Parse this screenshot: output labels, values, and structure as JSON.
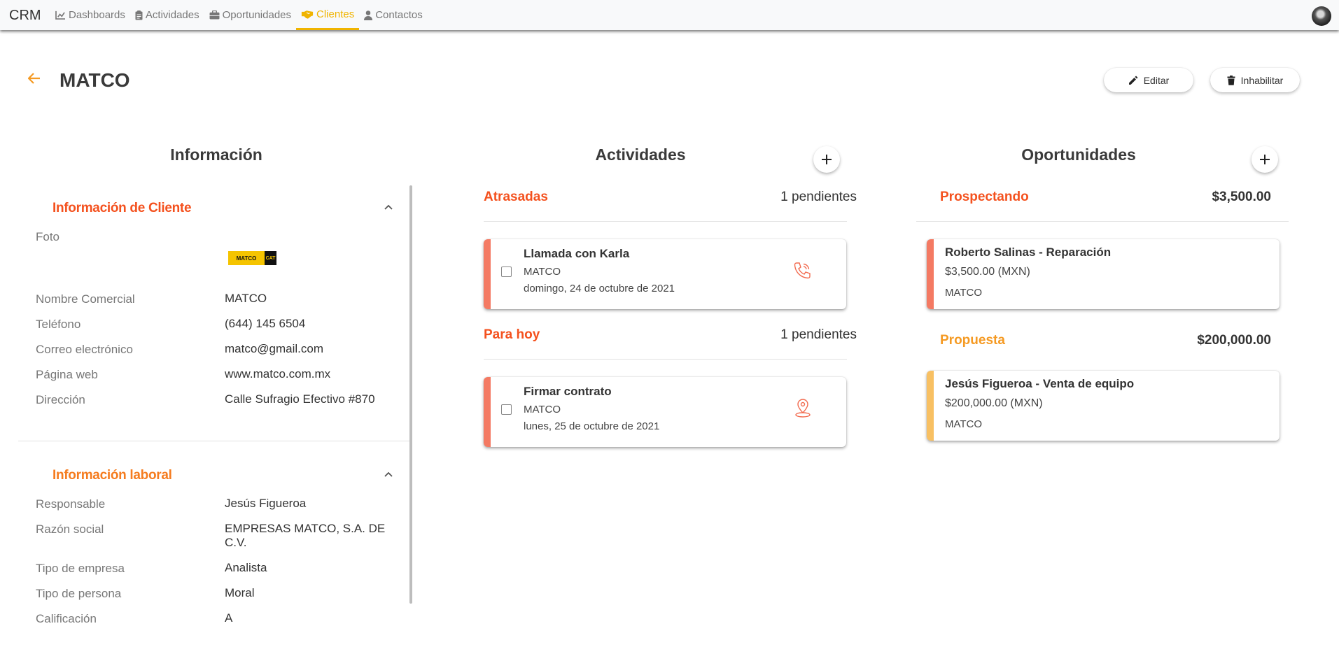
{
  "nav": {
    "brand": "CRM",
    "items": [
      {
        "label": "Dashboards",
        "icon": "chart-line-icon"
      },
      {
        "label": "Actividades",
        "icon": "clipboard-icon"
      },
      {
        "label": "Oportunidades",
        "icon": "briefcase-icon"
      },
      {
        "label": "Clientes",
        "icon": "handshake-icon",
        "active": true
      },
      {
        "label": "Contactos",
        "icon": "user-icon"
      }
    ],
    "accent_color": "#f0b400"
  },
  "header": {
    "title": "MATCO",
    "edit_label": "Editar",
    "disable_label": "Inhabilitar"
  },
  "info": {
    "title": "Información",
    "client_section": {
      "title": "Información de Cliente",
      "color": "#f4511e",
      "photo_label": "Foto",
      "logo_text": "MATCO",
      "logo_badge": "CAT",
      "fields": [
        {
          "label": "Nombre Comercial",
          "value": "MATCO"
        },
        {
          "label": "Teléfono",
          "value": "(644) 145 6504"
        },
        {
          "label": "Correo electrónico",
          "value": "matco@gmail.com"
        },
        {
          "label": "Página web",
          "value": "www.matco.com.mx"
        },
        {
          "label": "Dirección",
          "value": "Calle Sufragio Efectivo #870"
        }
      ]
    },
    "work_section": {
      "title": "Información laboral",
      "color": "#f57c1f",
      "fields": [
        {
          "label": "Responsable",
          "value": "Jesús Figueroa"
        },
        {
          "label": "Razón social",
          "value": "EMPRESAS MATCO, S.A. DE C.V."
        },
        {
          "label": "Tipo de empresa",
          "value": "Analista"
        },
        {
          "label": "Tipo de persona",
          "value": "Moral"
        },
        {
          "label": "Calificación",
          "value": "A"
        }
      ]
    }
  },
  "activities": {
    "title": "Actividades",
    "groups": [
      {
        "title": "Atrasadas",
        "pending": "1 pendientes",
        "color": "#f4511e",
        "items": [
          {
            "title": "Llamada con Karla",
            "company": "MATCO",
            "date": "domingo, 24 de octubre de 2021",
            "icon": "phone-icon"
          }
        ]
      },
      {
        "title": "Para hoy",
        "pending": "1 pendientes",
        "color": "#f4511e",
        "items": [
          {
            "title": "Firmar contrato",
            "company": "MATCO",
            "date": "lunes, 25 de octubre de 2021",
            "icon": "location-pin-icon"
          }
        ]
      }
    ],
    "stripe_color": "#f47a63"
  },
  "opportunities": {
    "title": "Oportunidades",
    "groups": [
      {
        "title": "Prospectando",
        "amount": "$3,500.00",
        "color": "#f4511e",
        "stripe_color": "#f47a63",
        "items": [
          {
            "title": "Roberto Salinas - Reparación",
            "amount": "$3,500.00 (MXN)",
            "company": "MATCO"
          }
        ]
      },
      {
        "title": "Propuesta",
        "amount": "$200,000.00",
        "color": "#f59a23",
        "stripe_color": "#f8c063",
        "items": [
          {
            "title": "Jesús Figueroa - Venta de equipo",
            "amount": "$200,000.00 (MXN)",
            "company": "MATCO"
          }
        ]
      }
    ]
  }
}
